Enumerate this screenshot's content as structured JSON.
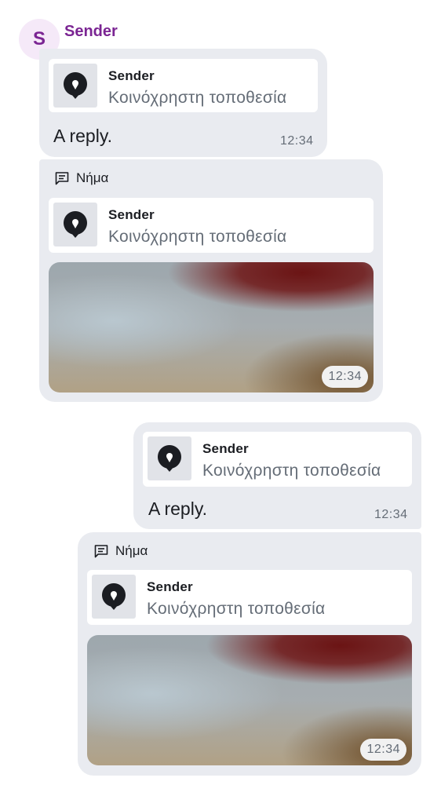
{
  "sender": {
    "initial": "S",
    "name": "Sender",
    "color": "#7b2593"
  },
  "messages": [
    {
      "quote": {
        "sender": "Sender",
        "text": "Κοινόχρηστη τοποθεσία",
        "icon": "location-pin-icon"
      },
      "text": "A reply.",
      "time": "12:34"
    },
    {
      "thread_label": "Νήμα",
      "thread_icon": "thread-icon",
      "quote": {
        "sender": "Sender",
        "text": "Κοινόχρηστη τοποθεσία",
        "icon": "location-pin-icon"
      },
      "media_time": "12:34"
    },
    {
      "quote": {
        "sender": "Sender",
        "text": "Κοινόχρηστη τοποθεσία",
        "icon": "location-pin-icon"
      },
      "text": "A reply.",
      "time": "12:34"
    },
    {
      "thread_label": "Νήμα",
      "thread_icon": "thread-icon",
      "quote": {
        "sender": "Sender",
        "text": "Κοινόχρηστη τοποθεσία",
        "icon": "location-pin-icon"
      },
      "media_time": "12:34"
    }
  ]
}
